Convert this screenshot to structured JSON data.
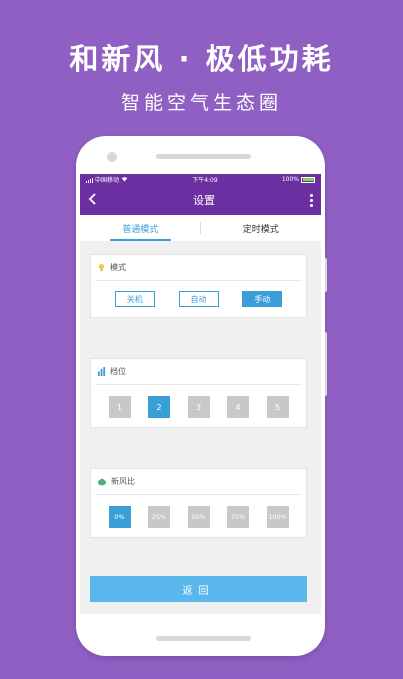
{
  "promo": {
    "headline": "和新风 · 极低功耗",
    "subline": "智能空气生态圈"
  },
  "status_bar": {
    "carrier": "中国移动",
    "time": "下午4:09",
    "battery": "100%"
  },
  "app_bar": {
    "title": "设置"
  },
  "tabs": [
    {
      "label": "普通模式",
      "active": true
    },
    {
      "label": "定时模式",
      "active": false
    }
  ],
  "mode_card": {
    "title": "模式",
    "options": [
      {
        "label": "关机",
        "selected": false
      },
      {
        "label": "自动",
        "selected": false
      },
      {
        "label": "手动",
        "selected": true
      }
    ]
  },
  "level_card": {
    "title": "档位",
    "options": [
      {
        "label": "1",
        "selected": false
      },
      {
        "label": "2",
        "selected": true
      },
      {
        "label": "3",
        "selected": false
      },
      {
        "label": "4",
        "selected": false
      },
      {
        "label": "5",
        "selected": false
      }
    ]
  },
  "fresh_card": {
    "title": "新风比",
    "options": [
      {
        "label": "0%",
        "selected": true
      },
      {
        "label": "25%",
        "selected": false
      },
      {
        "label": "50%",
        "selected": false
      },
      {
        "label": "75%",
        "selected": false
      },
      {
        "label": "100%",
        "selected": false
      }
    ]
  },
  "return_button": {
    "label": "返回"
  },
  "colors": {
    "background": "#8f5fc3",
    "app_bar": "#6b2fa2",
    "accent": "#3a9fd8",
    "return_button": "#5ab7ec",
    "inactive_square": "#c8c8c8"
  },
  "icons": {
    "back": "chevron-left-icon",
    "menu": "more-vertical-icon",
    "mode": "lightbulb-icon",
    "level": "bar-chart-icon",
    "fresh": "cloud-icon"
  }
}
